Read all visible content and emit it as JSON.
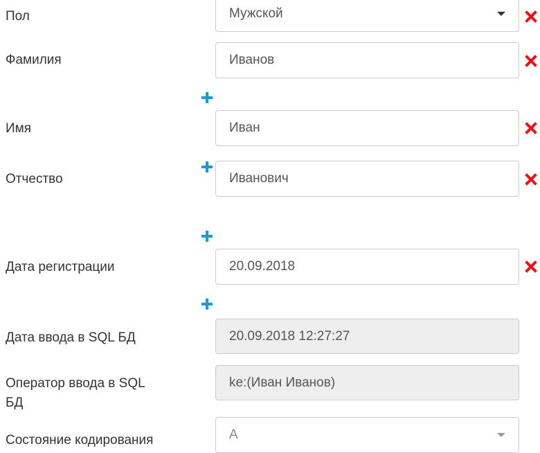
{
  "form": {
    "gender": {
      "label": "Пол",
      "value": "Мужской"
    },
    "surname": {
      "label": "Фамилия",
      "value": "Иванов"
    },
    "first_name": {
      "label": "Имя",
      "value": "Иван"
    },
    "patronymic": {
      "label": "Отчество",
      "value": "Иванович"
    },
    "registration_date": {
      "label": "Дата регистрации",
      "value": "20.09.2018"
    },
    "sql_entry_date": {
      "label": "Дата ввода в SQL БД",
      "value": "20.09.2018 12:27:27"
    },
    "sql_operator": {
      "label_line1": "Оператор ввода в SQL",
      "label_line2": "БД",
      "value": "ke:(Иван Иванов)"
    },
    "coding_state": {
      "label": "Состояние кодирования",
      "value": "A"
    }
  },
  "icons": {
    "remove": "close-icon",
    "add": "plus-icon"
  },
  "colors": {
    "remove": "#ee1111",
    "add": "#1a9ad6",
    "readonly_bg": "#eeeeee",
    "border": "#cccccc"
  }
}
